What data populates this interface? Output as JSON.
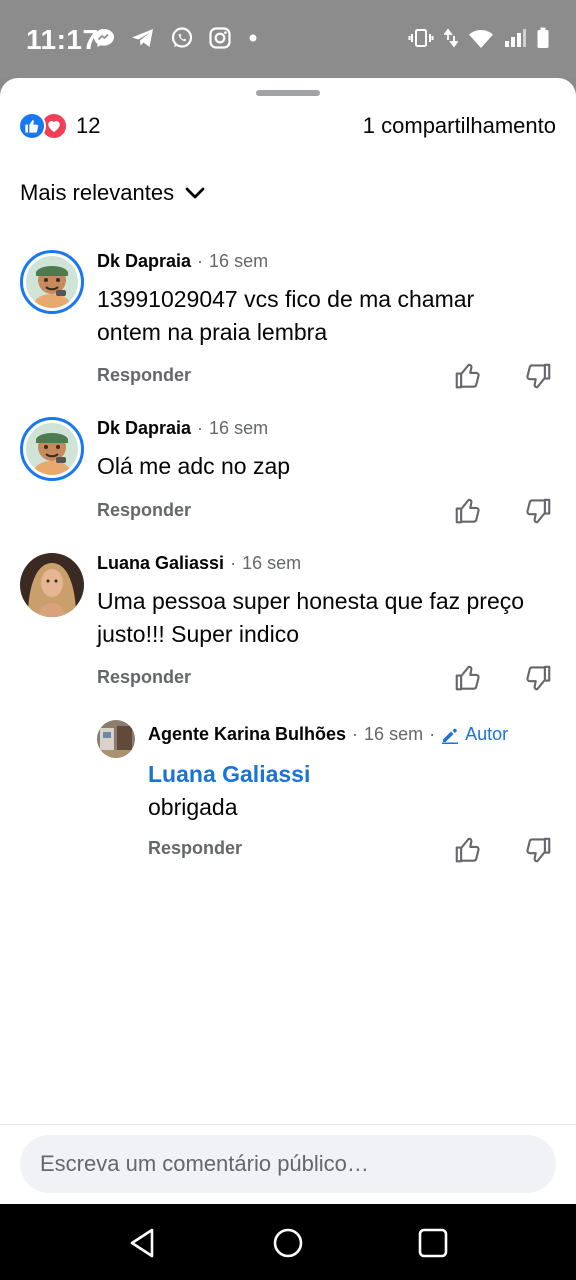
{
  "status_bar": {
    "time": "11:17",
    "left_icons": [
      "messenger-bubble-icon",
      "telegram-icon",
      "whatsapp-icon",
      "instagram-icon",
      "dot-icon"
    ],
    "right_icons": [
      "vibrate-icon",
      "data-arrows-icon",
      "wifi-icon",
      "signal-icon",
      "battery-icon"
    ]
  },
  "summary": {
    "reaction_count": "12",
    "shares": "1 compartilhamento"
  },
  "sort": {
    "label": "Mais relevantes"
  },
  "comments": [
    {
      "name": "Dk Dapraia",
      "time": "16 sem",
      "text": "13991029047 vcs fico de ma chamar ontem na praia lembra",
      "reply_label": "Responder"
    },
    {
      "name": "Dk Dapraia",
      "time": "16 sem",
      "text": "Olá me adc no zap",
      "reply_label": "Responder"
    },
    {
      "name": "Luana Galiassi",
      "time": "16 sem",
      "text": "Uma pessoa super honesta que faz preço justo!!! Super indico",
      "reply_label": "Responder"
    }
  ],
  "reply": {
    "name": "Agente Karina Bulhões",
    "time": "16 sem",
    "badge": "Autor",
    "mention": "Luana Galiassi",
    "text": "obrigada",
    "reply_label": "Responder"
  },
  "separator": "·",
  "composer": {
    "placeholder": "Escreva um comentário público…"
  },
  "colors": {
    "accent": "#1877f2",
    "love": "#f33e58",
    "muted": "#65676b",
    "mention": "#1a73d8"
  }
}
